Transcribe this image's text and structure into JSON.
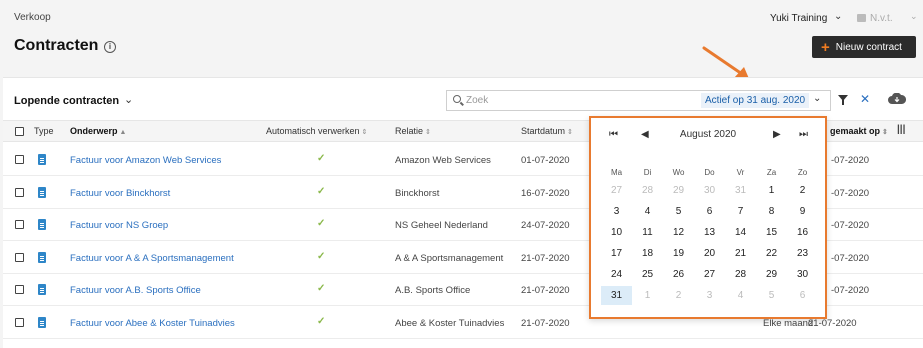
{
  "header": {
    "breadcrumb": "Verkoop",
    "title": "Contracten",
    "org_label": "Yuki Training",
    "secondary_label": "N.v.t.",
    "new_button_label": "Nieuw contract"
  },
  "toolbar": {
    "view_label": "Lopende contracten",
    "search_placeholder": "Zoek",
    "filter_chip": "Actief op 31 aug. 2020",
    "clear_label": "✕"
  },
  "table": {
    "columns": {
      "type": "Type",
      "subject": "Onderwerp",
      "auto": "Automatisch verwerken",
      "relation": "Relatie",
      "start": "Startdatum",
      "created": "gemaakt op"
    },
    "rows": [
      {
        "subject": "Factuur voor Amazon Web Services",
        "relation": "Amazon Web Services",
        "start": "01-07-2020",
        "created": "-07-2020",
        "freq": ""
      },
      {
        "subject": "Factuur voor Binckhorst",
        "relation": "Binckhorst",
        "start": "16-07-2020",
        "created": "-07-2020",
        "freq": ""
      },
      {
        "subject": "Factuur voor NS Groep",
        "relation": "NS Geheel Nederland",
        "start": "24-07-2020",
        "created": "-07-2020",
        "freq": ""
      },
      {
        "subject": "Factuur voor A & A Sportsmanagement",
        "relation": "A & A Sportsmanagement",
        "start": "21-07-2020",
        "created": "-07-2020",
        "freq": ""
      },
      {
        "subject": "Factuur voor A.B. Sports Office",
        "relation": "A.B. Sports Office",
        "start": "21-07-2020",
        "created": "-07-2020",
        "freq": ""
      },
      {
        "subject": "Factuur voor Abee & Koster Tuinadvies",
        "relation": "Abee & Koster Tuinadvies",
        "start": "21-07-2020",
        "created": "21-07-2020",
        "freq": "Elke maand"
      }
    ]
  },
  "calendar": {
    "month_label": "August 2020",
    "nav": {
      "first": "⏮",
      "prev": "◀",
      "next": "▶",
      "last": "⏭"
    },
    "weekdays": [
      "Ma",
      "Di",
      "Wo",
      "Do",
      "Vr",
      "Za",
      "Zo"
    ],
    "weeks": [
      [
        "27",
        "28",
        "29",
        "30",
        "31",
        "1",
        "2"
      ],
      [
        "3",
        "4",
        "5",
        "6",
        "7",
        "8",
        "9"
      ],
      [
        "10",
        "11",
        "12",
        "13",
        "14",
        "15",
        "16"
      ],
      [
        "17",
        "18",
        "19",
        "20",
        "21",
        "22",
        "23"
      ],
      [
        "24",
        "25",
        "26",
        "27",
        "28",
        "29",
        "30"
      ],
      [
        "31",
        "1",
        "2",
        "3",
        "4",
        "5",
        "6"
      ]
    ],
    "selected": "31",
    "accent_color": "#e87a2f"
  },
  "icons": {
    "info": "info-icon",
    "chevron": "chevron-down-icon",
    "filter": "filter-icon",
    "cloud": "cloud-download-icon",
    "doc": "document-icon",
    "check": "check-icon"
  }
}
